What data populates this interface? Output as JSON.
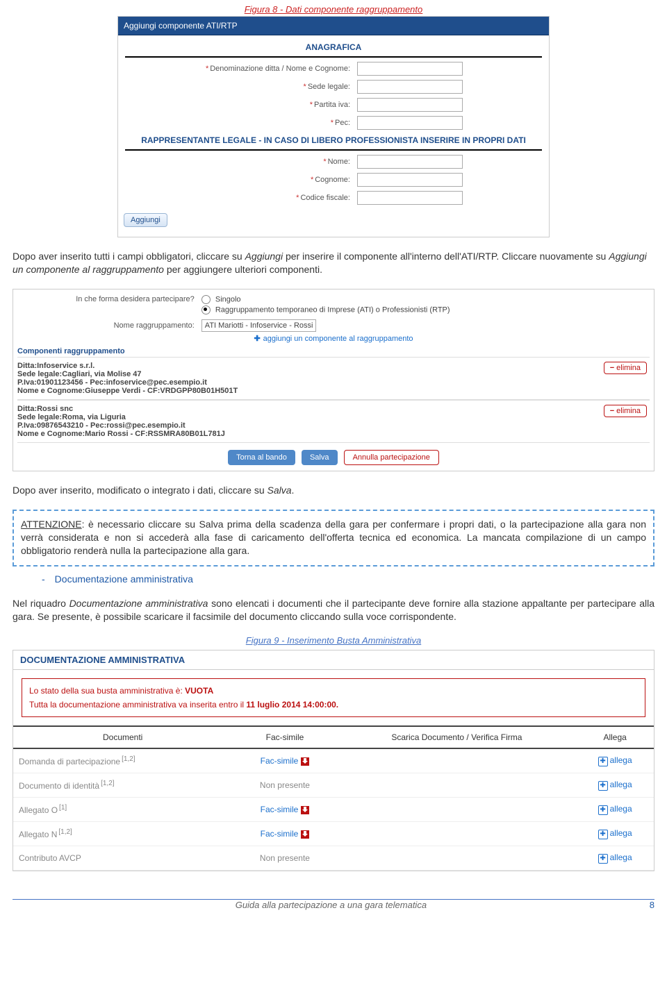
{
  "fig8_caption": "Figura 8 - Dati componente raggruppamento",
  "form": {
    "header": "Aggiungi componente ATI/RTP",
    "sec1": "ANAGRAFICA",
    "l_den": "Denominazione ditta / Nome e Cognome:",
    "l_sede": "Sede legale:",
    "l_piva": "Partita iva:",
    "l_pec": "Pec:",
    "sec2": "RAPPRESENTANTE LEGALE - IN CASO DI LIBERO PROFESSIONISTA INSERIRE IN PROPRI DATI",
    "l_nome": "Nome:",
    "l_cog": "Cognome:",
    "l_cf": "Codice fiscale:",
    "btn_add": "Aggiungi"
  },
  "p1": "Dopo aver inserito tutti i campi obbligatori, cliccare su Aggiungi per inserire il componente all'interno dell'ATI/RTP. Cliccare nuovamente su Aggiungi un componente al raggruppamento per aggiungere ulteriori componenti.",
  "wide": {
    "q_forma": "In che forma desidera partecipare?",
    "opt1": "Singolo",
    "opt2": "Raggruppamento temporaneo di Imprese (ATI) o Professionisti (RTP)",
    "l_nome_r": "Nome raggruppamento:",
    "v_nome_r": "ATI Mariotti - Infoservice - Rossi",
    "addlink": "aggiungi un componente al raggruppamento",
    "sect_comp": "Componenti raggruppamento",
    "c1_1": "Ditta:Infoservice s.r.l.",
    "c1_2": "Sede legale:Cagliari, via Molise 47",
    "c1_3": "P.Iva:01901123456 - Pec:infoservice@pec.esempio.it",
    "c1_4": "Nome e Cognome:Giuseppe Verdi - CF:VRDGPP80B01H501T",
    "c2_1": "Ditta:Rossi snc",
    "c2_2": "Sede legale:Roma, via Liguria",
    "c2_3": "P.Iva:09876543210 - Pec:rossi@pec.esempio.it",
    "c2_4": "Nome e Cognome:Mario Rossi - CF:RSSMRA80B01L781J",
    "elim": "elimina",
    "b_torna": "Torna al bando",
    "b_salva": "Salva",
    "b_annulla": "Annulla partecipazione"
  },
  "p2": "Dopo aver inserito, modificato o integrato i dati, cliccare su Salva.",
  "warn_pre": "ATTENZIONE",
  "warn": ": è necessario cliccare su Salva prima della scadenza della gara per confermare i propri dati, o la partecipazione alla gara non verrà considerata e non si accederà alla fase di caricamento dell'offerta tecnica ed economica. La mancata compilazione di un campo obbligatorio renderà nulla la partecipazione alla gara.",
  "sub_title": "Documentazione amministrativa",
  "p3": "Nel riquadro Documentazione amministrativa sono elencati i documenti che il partecipante deve fornire alla stazione appaltante per partecipare alla gara. Se presente, è possibile scaricare il facsimile del documento cliccando sulla voce corrispondente.",
  "fig9_caption": "Figura 9 - Inserimento Busta Amministrativa",
  "doc": {
    "h": "DOCUMENTAZIONE AMMINISTRATIVA",
    "a1_a": "Lo stato della sua busta amministrativa è: ",
    "a1_b": "VUOTA",
    "a2_a": "Tutta la documentazione amministrativa va inserita entro il ",
    "a2_b": "11 luglio 2014 14:00:00.",
    "th1": "Documenti",
    "th2": "Fac-simile",
    "th3": "Scarica Documento / Verifica Firma",
    "th4": "Allega",
    "rows": [
      {
        "d": "Domanda di partecipazione",
        "sup": "[1,2]",
        "fs": "Fac-simile",
        "dl": true,
        "al": "allega"
      },
      {
        "d": "Documento di identità",
        "sup": "[1,2]",
        "fs": "Non presente",
        "dl": false,
        "al": "allega"
      },
      {
        "d": "Allegato O",
        "sup": "[1]",
        "fs": "Fac-simile",
        "dl": true,
        "al": "allega"
      },
      {
        "d": "Allegato N",
        "sup": "[1,2]",
        "fs": "Fac-simile",
        "dl": true,
        "al": "allega"
      },
      {
        "d": "Contributo AVCP",
        "sup": "",
        "fs": "Non presente",
        "dl": false,
        "al": "allega"
      }
    ]
  },
  "ftr_l": "Guida alla partecipazione a una gara telematica",
  "ftr_r": "8"
}
